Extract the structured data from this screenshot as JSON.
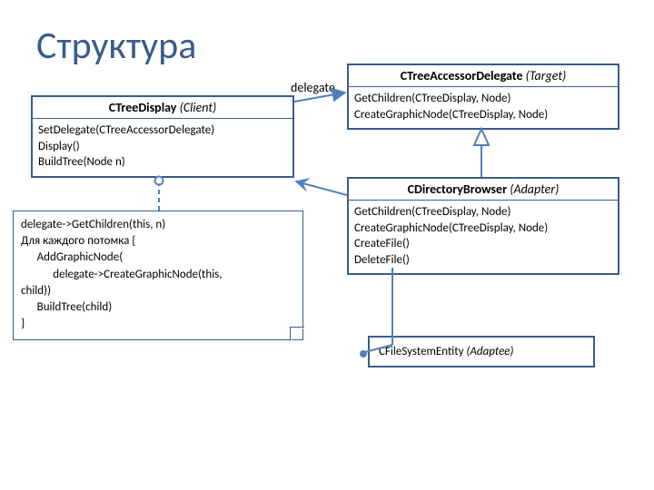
{
  "title": "Структура",
  "labels": {
    "delegate": "delegate"
  },
  "classes": {
    "treeDisplay": {
      "name": "CTreeDisplay",
      "role": "(Client)",
      "ops": "SetDelegate(CTreeAccessorDelegate)\nDisplay()\nBuildTree(Node n)"
    },
    "treeAccessorDelegate": {
      "name": "CTreeAccessorDelegate",
      "role": "(Target)",
      "ops": "GetChildren(CTreeDisplay, Node)\nCreateGraphicNode(CTreeDisplay, Node)"
    },
    "directoryBrowser": {
      "name": "CDirectoryBrowser",
      "role": "(Adapter)",
      "ops": "GetChildren(CTreeDisplay, Node)\nCreateGraphicNode(CTreeDisplay, Node)\nCreateFile()\nDeleteFile()"
    },
    "fileSystemEntity": {
      "name": "CFileSystemEntity",
      "role": "(Adaptee)"
    }
  },
  "note": {
    "text": "delegate->GetChildren(this, n)\nДля каждого потомка {\n      AddGraphicNode(\n            delegate->CreateGraphicNode(this,\nchild))\n      BuildTree(child)\n}"
  }
}
